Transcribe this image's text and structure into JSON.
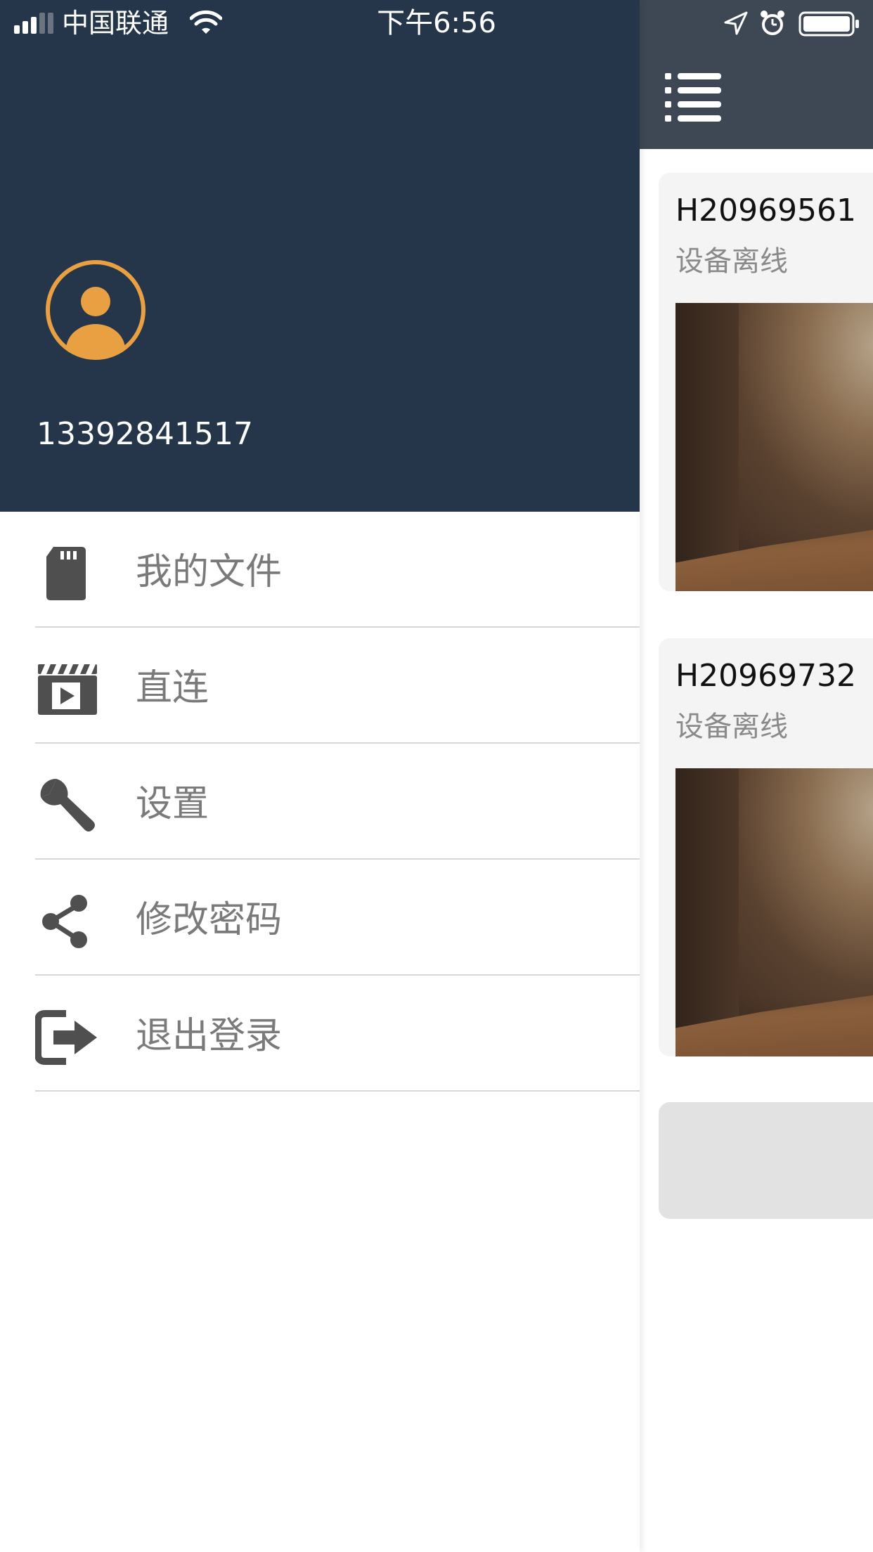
{
  "status_bar": {
    "carrier": "中国联通",
    "time": "下午6:56",
    "icons": [
      "signal-icon",
      "wifi-icon",
      "location-icon",
      "alarm-icon",
      "battery-icon"
    ]
  },
  "colors": {
    "drawer_header": "#26364a",
    "main_header": "#3d4854",
    "avatar_accent": "#e8a043",
    "menu_icon": "#4f4f4f",
    "menu_label": "#7a7a7a"
  },
  "drawer": {
    "phone": "13392841517",
    "menu": [
      {
        "label": "我的文件",
        "icon": "sd-card-icon"
      },
      {
        "label": "直连",
        "icon": "clapperboard-icon"
      },
      {
        "label": "设置",
        "icon": "wrench-icon"
      },
      {
        "label": "修改密码",
        "icon": "share-icon"
      },
      {
        "label": "退出登录",
        "icon": "logout-icon"
      }
    ]
  },
  "main": {
    "header_icon": "menu-list-icon",
    "devices": [
      {
        "id": "H20969561",
        "status": "设备离线"
      },
      {
        "id": "H20969732",
        "status": "设备离线"
      }
    ]
  }
}
